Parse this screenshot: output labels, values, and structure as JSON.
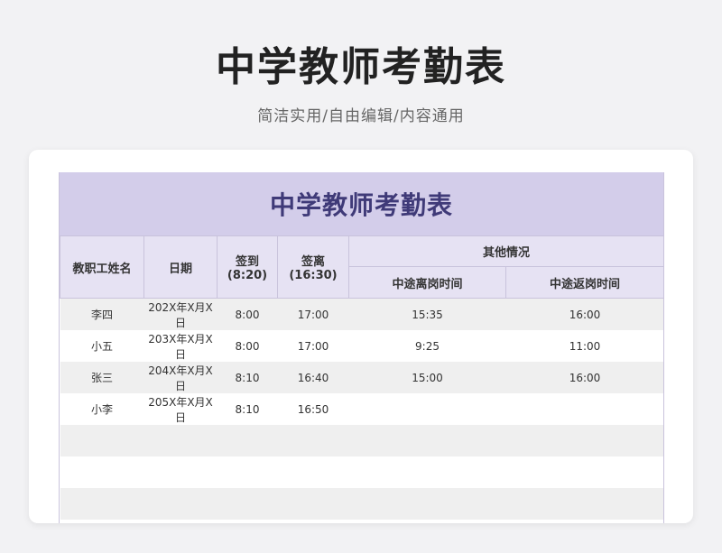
{
  "page": {
    "title": "中学教师考勤表",
    "subtitle": "简洁实用/自由编辑/内容通用"
  },
  "sheet": {
    "title": "中学教师考勤表",
    "headers": {
      "name": "教职工姓名",
      "date": "日期",
      "checkin": "签到\n(8:20)",
      "checkout": "签离\n(16:30)",
      "other": "其他情况",
      "leave_time": "中途离岗时间",
      "return_time": "中途返岗时间"
    },
    "rows": [
      {
        "name": "李四",
        "date": "202X年X月X日",
        "checkin": "8:00",
        "checkout": "17:00",
        "leave": "15:35",
        "return": "16:00"
      },
      {
        "name": "小五",
        "date": "203X年X月X日",
        "checkin": "8:00",
        "checkout": "17:00",
        "leave": "9:25",
        "return": "11:00"
      },
      {
        "name": "张三",
        "date": "204X年X月X日",
        "checkin": "8:10",
        "checkout": "16:40",
        "leave": "15:00",
        "return": "16:00"
      },
      {
        "name": "小李",
        "date": "205X年X月X日",
        "checkin": "8:10",
        "checkout": "16:50",
        "leave": "",
        "return": ""
      },
      {
        "name": "",
        "date": "",
        "checkin": "",
        "checkout": "",
        "leave": "",
        "return": ""
      },
      {
        "name": "",
        "date": "",
        "checkin": "",
        "checkout": "",
        "leave": "",
        "return": ""
      },
      {
        "name": "",
        "date": "",
        "checkin": "",
        "checkout": "",
        "leave": "",
        "return": ""
      }
    ]
  },
  "colors": {
    "header_bg": "#d3cdea",
    "title_text": "#3f3a78",
    "subheader_bg": "#e6e2f3",
    "stripe": "#efefef"
  }
}
